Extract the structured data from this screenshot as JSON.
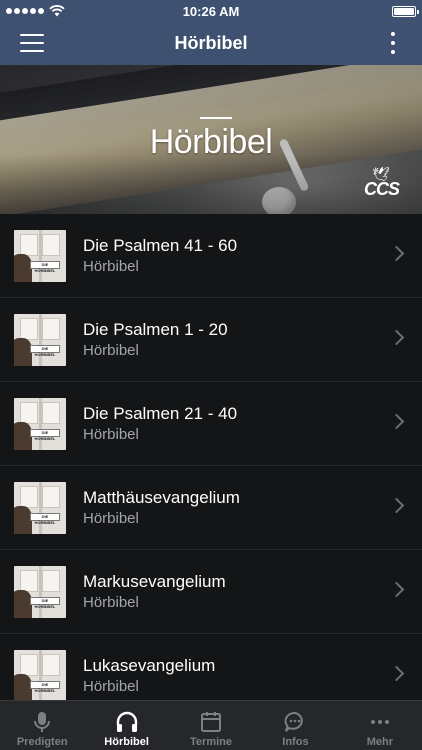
{
  "status_bar": {
    "time": "10:26 AM"
  },
  "nav": {
    "title": "Hörbibel",
    "menu_icon": "hamburger-menu-icon",
    "more_icon": "more-vertical-icon"
  },
  "banner": {
    "title": "Hörbibel",
    "logo_text": "CCS"
  },
  "items": [
    {
      "title": "Die Psalmen 41 - 60",
      "subtitle": "Hörbibel",
      "thumb_label": "DIE HÖRBIBEL"
    },
    {
      "title": "Die Psalmen 1 - 20",
      "subtitle": "Hörbibel",
      "thumb_label": "DIE HÖRBIBEL"
    },
    {
      "title": "Die Psalmen 21 - 40",
      "subtitle": "Hörbibel",
      "thumb_label": "DIE HÖRBIBEL"
    },
    {
      "title": "Matthäusevangelium",
      "subtitle": "Hörbibel",
      "thumb_label": "DIE HÖRBIBEL"
    },
    {
      "title": "Markusevangelium",
      "subtitle": "Hörbibel",
      "thumb_label": "DIE HÖRBIBEL"
    },
    {
      "title": "Lukasevangelium",
      "subtitle": "Hörbibel",
      "thumb_label": "DIE HÖRBIBEL"
    }
  ],
  "tabs": [
    {
      "label": "Predigten",
      "icon": "microphone-icon",
      "active": false
    },
    {
      "label": "Hörbibel",
      "icon": "headphones-icon",
      "active": true
    },
    {
      "label": "Termine",
      "icon": "calendar-icon",
      "active": false
    },
    {
      "label": "Infos",
      "icon": "chat-bubble-icon",
      "active": false
    },
    {
      "label": "Mehr",
      "icon": "more-horizontal-icon",
      "active": false
    }
  ],
  "colors": {
    "nav_background": "#3e5170",
    "list_background": "#141517",
    "tab_bar_background": "#25272b",
    "tab_active": "#ffffff",
    "tab_inactive": "#7c7f84"
  }
}
